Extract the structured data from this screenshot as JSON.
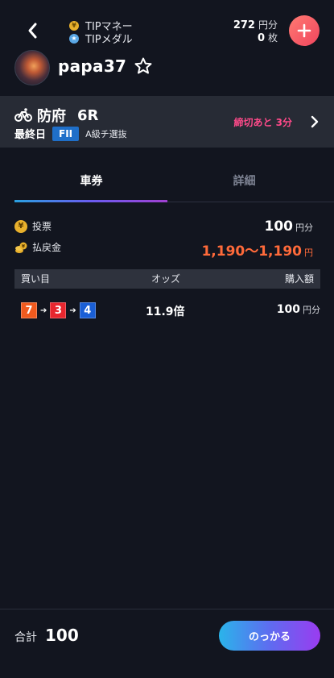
{
  "header": {
    "tip_money_label": "TIPマネー",
    "tip_money_value": "272",
    "tip_money_unit": "円分",
    "tip_medal_label": "TIPメダル",
    "tip_medal_value": "0",
    "tip_medal_unit": "枚",
    "back_icon": "chevron-left-icon",
    "add_icon": "plus-icon"
  },
  "profile": {
    "username": "papa37",
    "favorite_icon": "star-outline-icon"
  },
  "race": {
    "venue": "防府",
    "race_number": "6R",
    "day": "最終日",
    "grade": "FII",
    "race_class": "A級チ選抜",
    "deadline": "締切あと 3分"
  },
  "tabs": [
    {
      "label": "車券",
      "active": true
    },
    {
      "label": "詳細",
      "active": false
    }
  ],
  "summary": {
    "bet_label": "投票",
    "bet_value": "100",
    "bet_unit": "円分",
    "payout_label": "払戻金",
    "payout_value": "1,190〜1,190",
    "payout_unit": "円"
  },
  "table": {
    "headers": [
      "買い目",
      "オッズ",
      "購入額"
    ],
    "rows": [
      {
        "combo": [
          {
            "num": "7",
            "color": "#f05a1e"
          },
          {
            "num": "3",
            "color": "#e8262e"
          },
          {
            "num": "4",
            "color": "#1a5fd6"
          }
        ],
        "odds": "11.9倍",
        "amount": "100",
        "unit": "円分"
      }
    ]
  },
  "footer": {
    "total_label": "合計",
    "total_value": "100",
    "button_label": "のっかる"
  },
  "colors": {
    "background": "#12151f",
    "banner": "#272b35",
    "deadline": "#ff4a8a",
    "payout": "#ff6a3a",
    "grade": "#1f6fc9"
  }
}
